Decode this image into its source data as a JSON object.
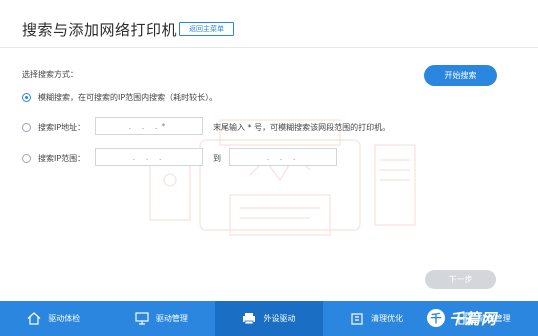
{
  "header": {
    "title": "搜索与添加网络打印机",
    "back_label": "返回主菜单"
  },
  "search": {
    "mode_label": "选择搜索方式：",
    "start_label": "开始搜索",
    "options": [
      {
        "label": "模糊搜索，在可搜索的IP范围内搜索（耗时较长）。",
        "selected": true
      },
      {
        "label": "搜索IP地址：",
        "selected": false
      },
      {
        "label": "搜索IP范围：",
        "selected": false
      }
    ],
    "ip_address_value": ".   .   .*",
    "ip_address_hint": "末尾输入 * 号，可模糊搜索该网段范围的打印机。",
    "range_start_value": ".   .   .",
    "range_to_label": "到",
    "range_end_value": ".   .   ."
  },
  "footer": {
    "next_label": "下一步"
  },
  "nav": {
    "items": [
      {
        "label": "驱动体检",
        "icon": "home-icon",
        "active": false
      },
      {
        "label": "驱动管理",
        "icon": "monitor-icon",
        "active": false
      },
      {
        "label": "外设驱动",
        "icon": "printer-icon",
        "active": true
      },
      {
        "label": "清理优化",
        "icon": "building-icon",
        "active": false
      },
      {
        "label": "软件管理",
        "icon": "grid-icon",
        "active": false
      }
    ]
  },
  "watermark": {
    "text": "千篇网"
  },
  "colors": {
    "accent": "#2b86e0",
    "active_nav": "#1a6fc4",
    "disabled": "#d3d6da"
  }
}
